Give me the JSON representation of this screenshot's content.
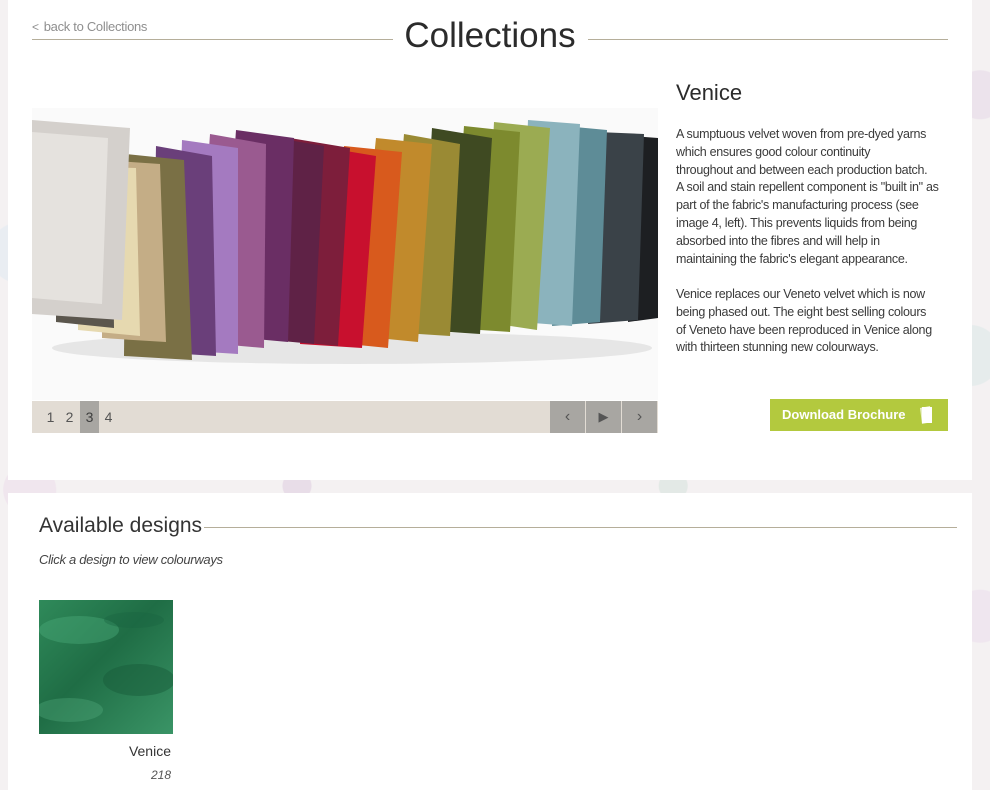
{
  "header": {
    "back_link": "back to Collections",
    "title": "Collections"
  },
  "carousel": {
    "pages": [
      "1",
      "2",
      "3",
      "4"
    ],
    "active_page": "3",
    "controls": {
      "prev": "‹",
      "play": "▶",
      "next": "›"
    }
  },
  "product": {
    "name": "Venice",
    "description_1": "A sumptuous velvet woven from pre-dyed yarns\nwhich ensures good colour continuity\nthroughout and between each production batch.\nA soil and stain repellent component is \"built in\" as\npart of the fabric's manufacturing process (see\nimage 4, left). This prevents liquids from being\nabsorbed into the fibres and will help in\nmaintaining the fabric's elegant appearance.",
    "description_2": "Venice replaces our Veneto velvet which is now\nbeing phased out. The eight best selling colours\nof Veneto have been reproduced in Venice along\nwith thirteen stunning new colourways.",
    "download_label": "Download Brochure"
  },
  "designs": {
    "title": "Available designs",
    "subtitle": "Click a design to view colourways",
    "items": [
      {
        "name": "Venice",
        "code": "218"
      }
    ]
  },
  "colors": {
    "accent_green": "#b3c93e",
    "divider": "#b5ae9a",
    "carousel_bar": "#e2dcd4",
    "carousel_active": "#a8a6a2"
  }
}
